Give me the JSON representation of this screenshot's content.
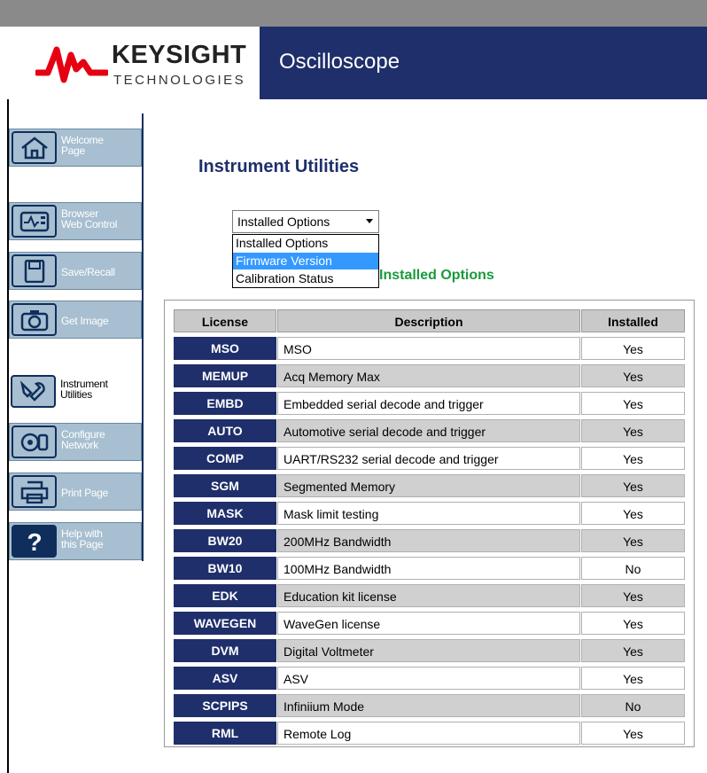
{
  "header": {
    "logo_main": "KEYSIGHT",
    "logo_sub": "TECHNOLOGIES",
    "title": "Oscilloscope",
    "brand_color": "#1f2f6b",
    "logo_wave_color": "#e60012"
  },
  "sidebar": {
    "items": [
      {
        "label": "Welcome\nPage",
        "icon": "home-icon",
        "active": false
      },
      {
        "label": "Browser\nWeb Control",
        "icon": "oscilloscope-icon",
        "active": false
      },
      {
        "label": "Save/Recall",
        "icon": "floppy-disk-icon",
        "active": false
      },
      {
        "label": "Get Image",
        "icon": "camera-icon",
        "active": false
      },
      {
        "label": "Instrument\nUtilities",
        "icon": "tools-icon",
        "active": true
      },
      {
        "label": "Configure\nNetwork",
        "icon": "network-icon",
        "active": false
      },
      {
        "label": "Print Page",
        "icon": "printer-icon",
        "active": false
      },
      {
        "label": "Help with\nthis Page",
        "icon": "help-icon",
        "active": false
      }
    ]
  },
  "main": {
    "page_title": "Instrument Utilities",
    "select": {
      "value": "Installed Options",
      "options": [
        "Installed Options",
        "Firmware Version",
        "Calibration Status"
      ],
      "highlighted": "Firmware Version"
    },
    "section_heading": "Installed Options"
  },
  "table": {
    "headers": [
      "License",
      "Description",
      "Installed"
    ],
    "rows": [
      {
        "license": "MSO",
        "description": "MSO",
        "installed": "Yes"
      },
      {
        "license": "MEMUP",
        "description": "Acq Memory Max",
        "installed": "Yes"
      },
      {
        "license": "EMBD",
        "description": "Embedded serial decode and trigger",
        "installed": "Yes"
      },
      {
        "license": "AUTO",
        "description": "Automotive serial decode and trigger",
        "installed": "Yes"
      },
      {
        "license": "COMP",
        "description": "UART/RS232 serial decode and trigger",
        "installed": "Yes"
      },
      {
        "license": "SGM",
        "description": "Segmented Memory",
        "installed": "Yes"
      },
      {
        "license": "MASK",
        "description": "Mask limit testing",
        "installed": "Yes"
      },
      {
        "license": "BW20",
        "description": "200MHz Bandwidth",
        "installed": "Yes"
      },
      {
        "license": "BW10",
        "description": "100MHz Bandwidth",
        "installed": "No"
      },
      {
        "license": "EDK",
        "description": "Education kit license",
        "installed": "Yes"
      },
      {
        "license": "WAVEGEN",
        "description": "WaveGen license",
        "installed": "Yes"
      },
      {
        "license": "DVM",
        "description": "Digital Voltmeter",
        "installed": "Yes"
      },
      {
        "license": "ASV",
        "description": "ASV",
        "installed": "Yes"
      },
      {
        "license": "SCPIPS",
        "description": "Infiniium Mode",
        "installed": "No"
      },
      {
        "license": "RML",
        "description": "Remote Log",
        "installed": "Yes"
      }
    ]
  }
}
